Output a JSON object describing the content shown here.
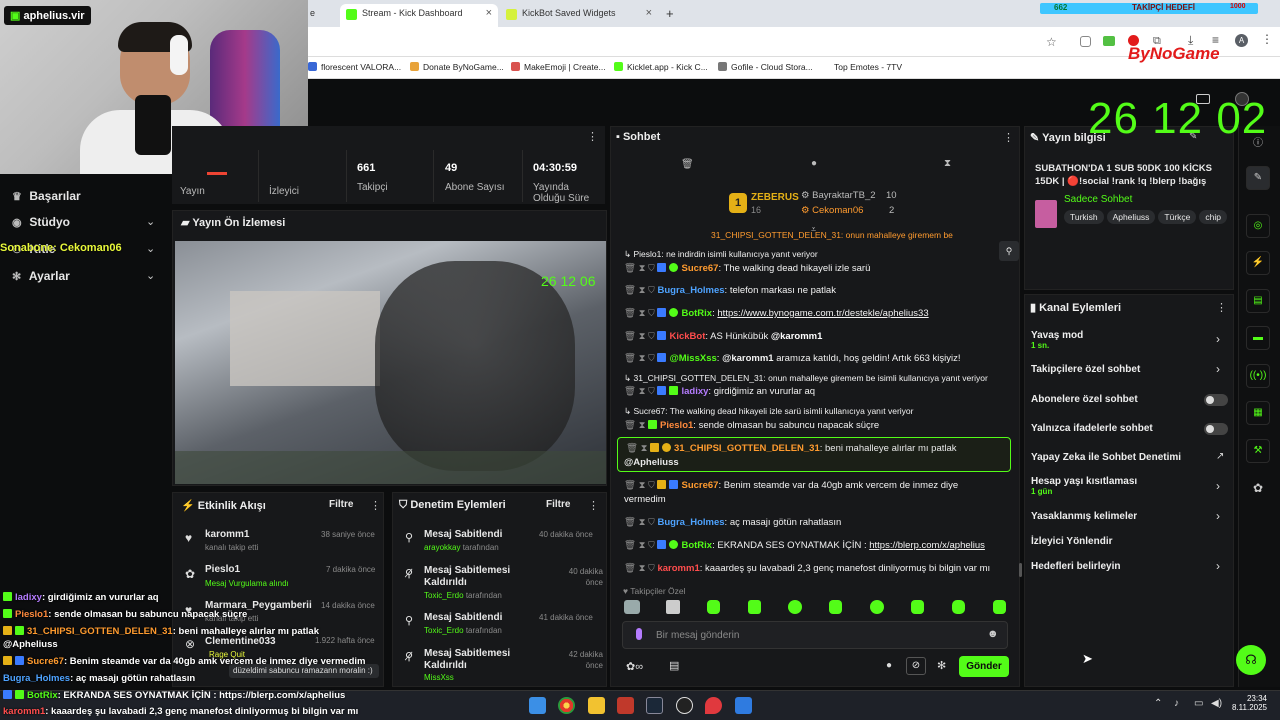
{
  "browser": {
    "tabs": [
      {
        "label": "e"
      },
      {
        "label": "Stream - Kick Dashboard"
      },
      {
        "label": "KickBot Saved Widgets"
      }
    ],
    "new_tab": "+",
    "bookmarks": [
      "florescent VALORA...",
      "Donate ByNoGame...",
      "MakeEmoji | Create...",
      "Kicklet.app - Kick C...",
      "Gofile - Cloud Stora...",
      "Top Emotes - 7TV"
    ]
  },
  "overlay": {
    "streamer_name": "aphelius.vir",
    "follower_goal_current": "662",
    "follower_goal_label": "TAKİPÇİ HEDEFİ",
    "follower_goal_target": "1000",
    "sponsor": "ByNoGame",
    "timer": "26 12 02",
    "chat_lines": [
      {
        "user": "ladixy",
        "text": ": girdiğimiz an vururlar aq",
        "color": "#b57cff"
      },
      {
        "user": "Pieslo1",
        "text": ": sende olmasan bu sabuncu napacak süçre",
        "color": "#ff8a3d"
      },
      {
        "user": "31_CHIPSI_GOTTEN_DELEN_31",
        "text": ": beni mahalleye alırlar mı patlak",
        "color": "#ff9b2f"
      },
      {
        "user": "",
        "text": "@Apheliuss",
        "color": "#ffffff"
      },
      {
        "user": "Sucre67",
        "text": ": Benim steamde var da 40gb amk vercem de inmez diye vermedim",
        "color": "#ff9b2f"
      },
      {
        "user": "Bugra_Holmes",
        "text": ": aç masajı götün rahatlasın",
        "color": "#4ea3ff"
      },
      {
        "user": "BotRix",
        "text": ": EKRANDA SES OYNATMAK İÇİN : https://blerp.com/x/aphelius",
        "color": "#53fc18"
      },
      {
        "user": "karomm1",
        "text": ": kaaardeş şu lavabadi 2,3 genç manefost dinliyormuş bi bilgin var mı",
        "color": "#ff4d4d"
      }
    ]
  },
  "nav": {
    "items": [
      {
        "label": "Başarılar"
      },
      {
        "label": "Stüdyo"
      },
      {
        "label": "Kitle"
      },
      {
        "label": "Ayarlar"
      }
    ],
    "alert_overlay": "Sonabone: Cekoman06"
  },
  "stats": [
    {
      "value": "",
      "label": "Yayın"
    },
    {
      "value": "",
      "label": "İzleyici"
    },
    {
      "value": "661",
      "label": "Takipçi"
    },
    {
      "value": "49",
      "label": "Abone Sayısı"
    },
    {
      "value": "04:30:59",
      "label": "Yayında Olduğu Süre"
    }
  ],
  "preview": {
    "title": "Yayın Ön İzlemesi",
    "timer": "26 12 06"
  },
  "activity": {
    "title": "Etkinlik Akışı",
    "filter": "Filtre",
    "items": [
      {
        "name": "karomm1",
        "sub": "kanalı takip etti",
        "time": "38 saniye önce"
      },
      {
        "name": "Pieslo1",
        "sub": "Mesaj Vurgulama alındı",
        "time": "7 dakika önce"
      },
      {
        "name": "Marmara_Peygamberii",
        "sub": "kanalı takip etti",
        "time": "14 dakika önce"
      },
      {
        "name": "Clementine033",
        "sub": "Rage Quit",
        "time": "1.922 hafta önce"
      }
    ],
    "tooltip": "düzeldimi sabuncu ramazann moralin :)"
  },
  "moderation": {
    "title": "Denetim Eylemleri",
    "filter": "Filtre",
    "items": [
      {
        "action": "Mesaj Sabitlendi",
        "by": "arayokkay",
        "suffix": "tarafından",
        "time": "40 dakika önce"
      },
      {
        "action": "Mesaj Sabitlemesi Kaldırıldı",
        "by": "Toxic_Erdo",
        "suffix": "tarafından",
        "time": "40 dakika önce"
      },
      {
        "action": "Mesaj Sabitlendi",
        "by": "Toxic_Erdo",
        "suffix": "tarafından",
        "time": "41 dakika önce"
      },
      {
        "action": "Mesaj Sabitlemesi Kaldırıldı",
        "by": "MissXss",
        "suffix": "tarafından",
        "time": "42 dakika önce"
      }
    ]
  },
  "chat": {
    "title": "Sohbet",
    "leaderboard": {
      "first": {
        "rank": "1",
        "name": "ZEBERUS",
        "count": "16"
      },
      "others": [
        {
          "name": "BayraktarTB_2",
          "count": "10"
        },
        {
          "name": "Cekoman06",
          "count": "2"
        }
      ]
    },
    "pinned_partial": "31_CHIPSI_GOTTEN_DELEN_31: onun mahalleye giremem be",
    "messages": [
      {
        "type": "reply",
        "text": "Pieslo1: ne indirdin isimli kullanıcıya yanıt veriyor"
      },
      {
        "user": "Sucre67",
        "color": "#ff9b2f",
        "text": ": The walking dead hikayeli izle sarü"
      },
      {
        "user": "Bugra_Holmes",
        "color": "#4ea3ff",
        "text": ": telefon markası ne patlak"
      },
      {
        "user": "BotRix",
        "color": "#53fc18",
        "text": ": ",
        "link": "https://www.bynogame.com.tr/destekle/aphelius33"
      },
      {
        "user": "KickBot",
        "color": "#ff4d4d",
        "text": ": AS Hünkübük ",
        "mention": "@karomm1"
      },
      {
        "user": "@MissXss",
        "color": "#53fc18",
        "text": ": ",
        "mention": "@karomm1",
        "text2": " aramıza katıldı, hoş geldin! Artık 663 kişiyiz!"
      },
      {
        "type": "reply",
        "text": "31_CHIPSI_GOTTEN_DELEN_31: onun mahalleye giremem be isimli kullanıcıya yanıt veriyor"
      },
      {
        "user": "ladixy",
        "color": "#b57cff",
        "text": ": girdiğimiz an vururlar aq"
      },
      {
        "type": "reply",
        "text": "Sucre67: The walking dead hikayeli izle sarü isimli kullanıcıya yanıt veriyor"
      },
      {
        "user": "Pieslo1",
        "color": "#ff8a3d",
        "text": ": sende olmasan bu sabuncu napacak süçre"
      },
      {
        "user": "31_CHIPSI_GOTTEN_DELEN_31",
        "color": "#ff9b2f",
        "text": ": beni mahalleye alırlar mı patlak",
        "mention": "@Apheliuss",
        "highlight": true
      },
      {
        "user": "Sucre67",
        "color": "#ff9b2f",
        "text": ": Benim steamde var da 40gb amk vercem de inmez diye",
        "text2": "vermedim"
      },
      {
        "user": "Bugra_Holmes",
        "color": "#4ea3ff",
        "text": ": aç masajı götün rahatlasın"
      },
      {
        "user": "BotRix",
        "color": "#53fc18",
        "text": ": EKRANDA SES OYNATMAK İÇİN : ",
        "link": "https://blerp.com/x/aphelius"
      },
      {
        "user": "karomm1",
        "color": "#ff4d4d",
        "text": ": kaaardeş şu lavabadi 2,3 genç manefost dinliyormuş bi bilgin var mı"
      }
    ],
    "followers_only": "Takipçiler Özel",
    "placeholder": "Bir mesaj gönderin",
    "send": "Gönder"
  },
  "stream_info": {
    "title": "Yayın bilgisi",
    "stream_title": "SUBATHON'DA 1 SUB 50DK 100 KİCKS 15DK | 🔴!social !rank !q !blerp !bağış",
    "category": "Sadece Sohbet",
    "tags": [
      "Turkish",
      "Apheliuss",
      "Türkçe",
      "chip"
    ]
  },
  "channel_actions": {
    "title": "Kanal Eylemleri",
    "items": [
      {
        "label": "Yavaş mod",
        "sub": "1 sn."
      },
      {
        "label": "Takipçilere özel sohbet",
        "sub": ""
      },
      {
        "label": "Abonelere özel sohbet",
        "sub": ""
      },
      {
        "label": "Yalnızca ifadelerle sohbet",
        "sub": ""
      },
      {
        "label": "Yapay Zeka ile Sohbet Denetimi",
        "sub": ""
      },
      {
        "label": "Hesap yaşı kısıtlaması",
        "sub": "1 gün"
      },
      {
        "label": "Yasaklanmış kelimeler",
        "sub": ""
      },
      {
        "label": "İzleyici Yönlendir",
        "sub": ""
      },
      {
        "label": "Hedefleri belirleyin",
        "sub": ""
      }
    ]
  },
  "taskbar": {
    "time": "23:34",
    "date": "8.11.2025"
  },
  "colors": {
    "accent": "#53fc18",
    "panel": "#17181a",
    "bg": "#0c0d0e"
  }
}
